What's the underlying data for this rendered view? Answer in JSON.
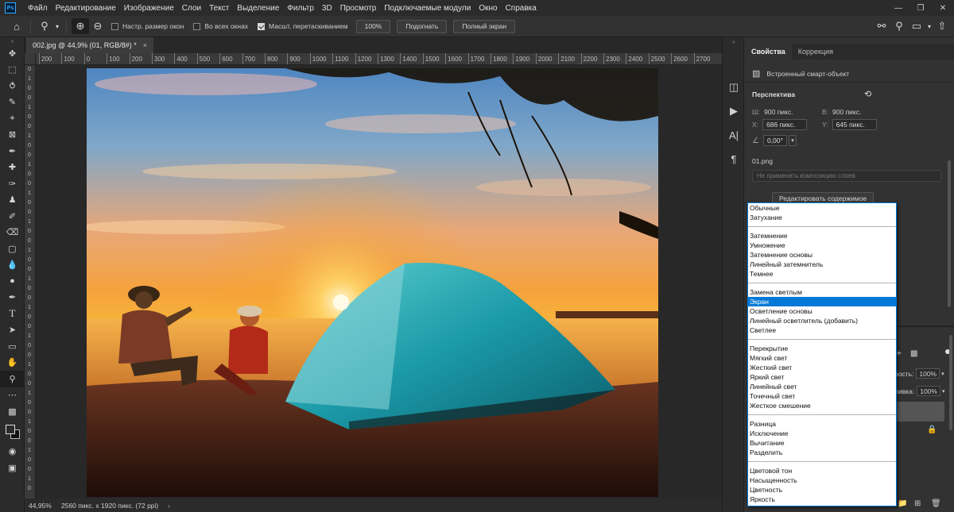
{
  "menu": {
    "items": [
      "Файл",
      "Редактирование",
      "Изображение",
      "Слои",
      "Текст",
      "Выделение",
      "Фильтр",
      "3D",
      "Просмотр",
      "Подключаемые модули",
      "Окно",
      "Справка"
    ]
  },
  "options_bar": {
    "resize_windows_label": "Настр. размер окон",
    "resize_windows_checked": false,
    "all_windows_label": "Во всех окнах",
    "all_windows_checked": false,
    "scrubby_zoom_label": "Масшт. перетаскиванием",
    "scrubby_zoom_checked": true,
    "zoom_100_label": "100%",
    "fit_label": "Подогнать",
    "fill_screen_label": "Полный экран"
  },
  "document": {
    "tab_title": "002.jpg @ 44,9% (01, RGB/8#) *",
    "ruler_top": [
      "200",
      "100",
      "0",
      "100",
      "200",
      "300",
      "400",
      "500",
      "600",
      "700",
      "800",
      "900",
      "1000",
      "1100",
      "1200",
      "1300",
      "1400",
      "1500",
      "1600",
      "1700",
      "1800",
      "1900",
      "2000",
      "2100",
      "2200",
      "2300",
      "2400",
      "2500",
      "2600",
      "2700"
    ],
    "ruler_left": [
      "0",
      "1",
      "0",
      "0",
      "1",
      "0",
      "0",
      "1",
      "0",
      "0",
      "1",
      "0",
      "0",
      "1",
      "0",
      "0",
      "1",
      "0",
      "0",
      "1",
      "0",
      "0",
      "1",
      "0",
      "0",
      "1",
      "0",
      "0",
      "1",
      "0",
      "0",
      "1",
      "0",
      "0",
      "1",
      "0",
      "0",
      "1",
      "0",
      "0",
      "1",
      "0",
      "0",
      "1",
      "0"
    ]
  },
  "status": {
    "zoom": "44,95%",
    "doc_info": "2560 пикс. x 1920 пикс. (72 ppi)",
    "arrow": "›"
  },
  "properties": {
    "tab_properties": "Свойства",
    "tab_adjustments": "Коррекция",
    "smart_object_label": "Встроенный смарт-объект",
    "section_title": "Перспектива",
    "w_label": "Ш:",
    "w_value": "900 пикс.",
    "h_label": "В:",
    "h_value": "900 пикс.",
    "x_label": "X:",
    "x_value": "686 пикс.",
    "y_label": "Y:",
    "y_value": "645 пикс.",
    "angle_value": "0,00°",
    "file_name": "01.png",
    "comp_placeholder": "Не применять композицию слоев",
    "edit_contents_label": "Редактировать содержимое"
  },
  "layers": {
    "opacity_label": "ность:",
    "opacity_value": "100%",
    "fill_label": "ливка:",
    "fill_value": "100%"
  },
  "blend_modes": {
    "selected": "Экран",
    "groups": [
      [
        "Обычные",
        "Затухание"
      ],
      [
        "Затемнение",
        "Умножение",
        "Затемнение основы",
        "Линейный затемнитель",
        "Темнее"
      ],
      [
        "Замена светлым",
        "Экран",
        "Осветление основы",
        "Линейный осветлитель (добавить)",
        "Светлее"
      ],
      [
        "Перекрытие",
        "Мягкий свет",
        "Жесткий свет",
        "Яркий свет",
        "Линейный свет",
        "Точечный свет",
        "Жесткое смешение"
      ],
      [
        "Разница",
        "Исключение",
        "Вычитание",
        "Разделить"
      ],
      [
        "Цветовой тон",
        "Насыщенность",
        "Цветность",
        "Яркость"
      ]
    ]
  },
  "colors": {
    "accent": "#0078d7",
    "app_bg": "#323232",
    "menubar_bg": "#2b2b2b"
  }
}
